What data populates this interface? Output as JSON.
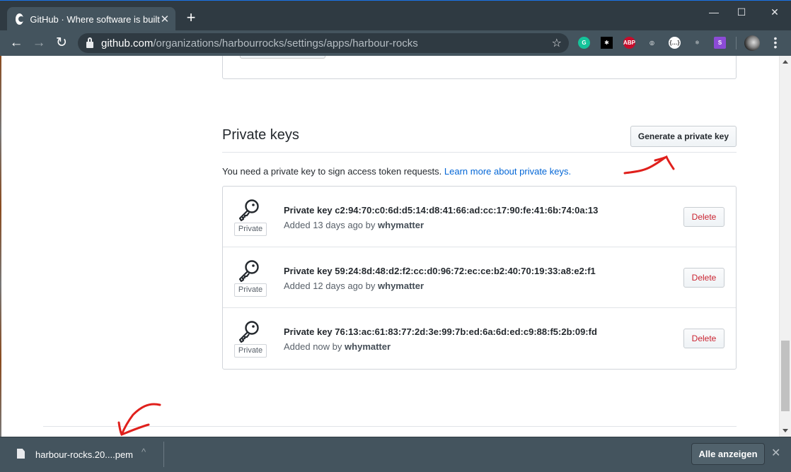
{
  "browser": {
    "tab_title": "GitHub · Where software is built",
    "tab_close": "✕",
    "new_tab": "+",
    "url_host": "github.com",
    "url_path": "/organizations/harbourrocks/settings/apps/harbour-rocks",
    "window_controls": {
      "minimize": "—",
      "maximize": "☐",
      "close": "✕"
    },
    "nav": {
      "back": "←",
      "forward": "→",
      "reload": "↻"
    },
    "bookmark_star": "☆",
    "extensions": [
      {
        "name": "grammarly",
        "label": "G",
        "color": "#15c39a"
      },
      {
        "name": "color-picker",
        "label": "✱",
        "color": "#000000"
      },
      {
        "name": "adblock-plus",
        "label": "ABP",
        "color": "#c70d2c"
      },
      {
        "name": "target",
        "label": "◎",
        "color": "#44545e"
      },
      {
        "name": "json-formatter",
        "label": "{…}",
        "color": "#ffffff"
      },
      {
        "name": "react-devtools",
        "label": "⚛",
        "color": "#44545e"
      },
      {
        "name": "snake",
        "label": "S",
        "color": "#8c4bd6"
      }
    ],
    "menu": "⋮"
  },
  "page": {
    "section_title": "Private keys",
    "generate_button": "Generate a private key",
    "description": "You need a private key to sign access token requests.",
    "learn_more_link": "Learn more about private keys.",
    "keys": [
      {
        "badge": "Private",
        "title": "Private key c2:94:70:c0:6d:d5:14:d8:41:66:ad:cc:17:90:fe:41:6b:74:0a:13",
        "added": "Added 13 days ago by",
        "user": "whymatter",
        "delete_label": "Delete"
      },
      {
        "badge": "Private",
        "title": "Private key 59:24:8d:48:d2:f2:cc:d0:96:72:ec:ce:b2:40:70:19:33:a8:e2:f1",
        "added": "Added 12 days ago by",
        "user": "whymatter",
        "delete_label": "Delete"
      },
      {
        "badge": "Private",
        "title": "Private key 76:13:ac:61:83:77:2d:3e:99:7b:ed:6a:6d:ed:c9:88:f5:2b:09:fd",
        "added": "Added now by",
        "user": "whymatter",
        "delete_label": "Delete"
      }
    ]
  },
  "downloads": {
    "file_name": "harbour-rocks.20....pem",
    "chevron": "^",
    "show_all": "Alle anzeigen",
    "close": "✕"
  },
  "colors": {
    "link": "#0366d6",
    "danger": "#cb2431",
    "annotation": "#e0201c"
  }
}
